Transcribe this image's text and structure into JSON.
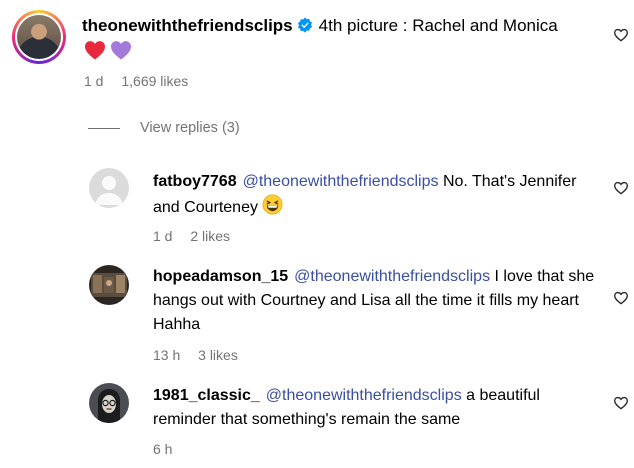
{
  "post_comment": {
    "username": "theonewiththefriendsclips",
    "text": "4th picture : Rachel and Monica",
    "age": "1 d",
    "likes": "1,669 likes",
    "hearts": [
      "red-heart-emoji",
      "purple-heart-emoji"
    ],
    "heart_colors": [
      "#e8283c",
      "#a37ad9"
    ]
  },
  "view_replies_label": "View replies (3)",
  "replies": [
    {
      "username": "fatboy7768",
      "mention": "@theonewiththefriendsclips",
      "text": " No. That's Jennifer and Courteney ",
      "emoji": "grinning-squinting-face-emoji",
      "age": "1 d",
      "likes": "2 likes"
    },
    {
      "username": "hopeadamson_15",
      "mention": "@theonewiththefriendsclips",
      "text": " I love that she hangs out with Courtney and Lisa all the time it fills my heart Hahha",
      "age": "13 h",
      "likes": "3 likes"
    },
    {
      "username": "1981_classic_",
      "mention": "@theonewiththefriendsclips",
      "text": " a beautiful reminder that something's remain the same",
      "age": "6 h",
      "likes": ""
    }
  ],
  "colors": {
    "mention": "#3a4fa0",
    "meta": "#737373",
    "verified": "#0095f6"
  }
}
